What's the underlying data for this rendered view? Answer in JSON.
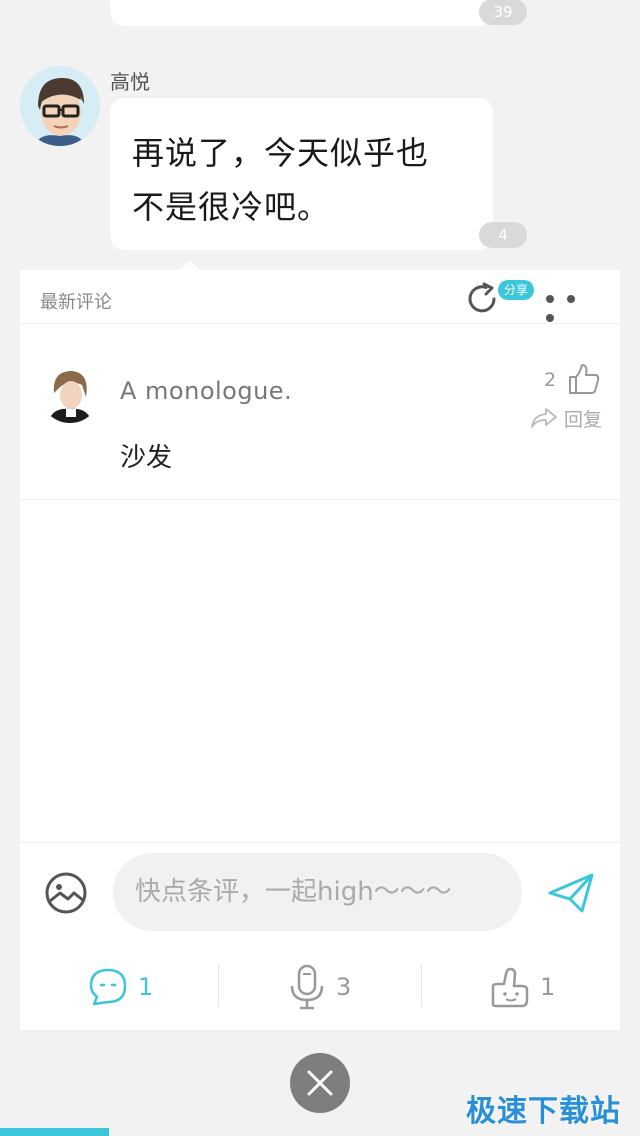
{
  "previous_message": {
    "count": "39"
  },
  "message": {
    "author": "高悦",
    "text_line1": "再说了，今天似乎也",
    "text_line2": "不是很冷吧。",
    "count": "4"
  },
  "comments_panel": {
    "title": "最新评论",
    "share_label": "分享",
    "comments": [
      {
        "user": "A monologue.",
        "text": "沙发",
        "likes": "2",
        "reply_label": "回复"
      }
    ]
  },
  "composer": {
    "placeholder": "快点条评，一起high～～～"
  },
  "bottom_bar": {
    "comments_count": "1",
    "voice_count": "3",
    "likes_count": "1",
    "active_color": "#3cc6d9",
    "inactive_color": "#999999"
  },
  "watermark": "极速下载站",
  "progress": {
    "fraction": 0.17,
    "color": "#3cc6d9"
  },
  "icons": [
    "refresh-share-icon",
    "more-dots-icon",
    "like-icon",
    "reply-arrow-icon",
    "image-icon",
    "send-icon",
    "comment-icon",
    "microphone-icon",
    "thumb-up-icon",
    "close-icon"
  ]
}
